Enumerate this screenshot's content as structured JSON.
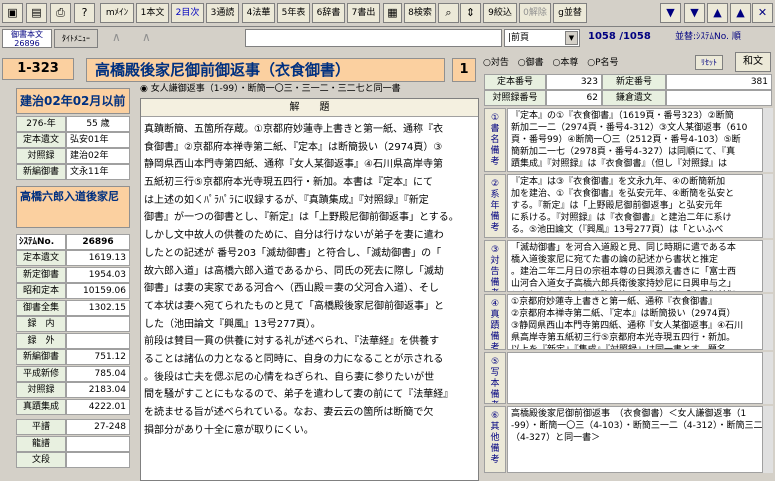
{
  "toolbar": {
    "buttons": [
      {
        "label": "mﾒｲﾝ"
      },
      {
        "label": "1本文"
      },
      {
        "label": "2目次"
      },
      {
        "label": "3通読"
      },
      {
        "label": "4法華"
      },
      {
        "label": "5年表"
      },
      {
        "label": "6辞書"
      },
      {
        "label": "7書出"
      },
      {
        "label": "8検索"
      },
      {
        "label": "9絞込"
      },
      {
        "label": "0解除"
      },
      {
        "label": "g並替"
      }
    ]
  },
  "tabs": {
    "main": "御書本文",
    "main_sub": "26896",
    "menu": "ﾀｲﾄﾒﾆｭｰ"
  },
  "nav": {
    "dropdown": "|前頁",
    "counter": "1058 /1058",
    "sort_label": "並替:ｼｽﾃﾑNo. 順"
  },
  "title": {
    "number": "1-323",
    "text": "高橋殿後家尼御前御返事（衣食御書）",
    "vol": "1"
  },
  "left": {
    "date_heading": "建治02年02月以前",
    "rows": [
      {
        "label": "276-年",
        "value": "55 歳"
      },
      {
        "label": "定本遺文",
        "value": "弘安01年"
      },
      {
        "label": "対照録",
        "value": "建治02年"
      },
      {
        "label": "新編御書",
        "value": "文永11年"
      }
    ],
    "recipient": "高橋六郎入道後家尼",
    "sysno_label": "ｼｽﾃﾑNo.",
    "sysno_value": "26896",
    "refs": [
      {
        "label": "定本遺文",
        "value": "1619.13"
      },
      {
        "label": "新定御書",
        "value": "1954.03"
      },
      {
        "label": "昭和定本",
        "value": "10159.06"
      },
      {
        "label": "御書全集",
        "value": "1302.15"
      },
      {
        "label": "録　内",
        "value": ""
      },
      {
        "label": "録　外",
        "value": ""
      },
      {
        "label": "新編御書",
        "value": "751.12"
      },
      {
        "label": "平成新修",
        "value": "785.04"
      },
      {
        "label": "対照録",
        "value": "2183.04"
      },
      {
        "label": "真蹟集成",
        "value": "4222.01"
      },
      {
        "label": "平譜",
        "value": "27-248"
      },
      {
        "label": "龍譜",
        "value": ""
      },
      {
        "label": "文段",
        "value": ""
      }
    ]
  },
  "middle": {
    "radio_text": "女人謙御返事（1-99）・断簡一〇三・三一二・三二七と同一書",
    "heading": "解　　題",
    "lines": [
      "真蹟断簡、五箇所存蔵。①京都府妙蓮寺上書きと第一紙、通称『衣",
      "食御書』②京都府本禅寺第二紙、『定本』は断簡扱い（2974頁）③",
      "静岡県西山本門寺第四紙、通称『女人某御返事』④石川県高岸寺第",
      "五紙初三行⑤京都府本光寺現五四行・新加。本書は『定本』にて",
      "は上述の如くﾊﾟﾗﾊﾟﾗに収録するが、『真蹟集成』『対照録』『新定",
      "御書』が一つの御書とし、『新定』は「上野殿尼御前御返事」とする。",
      "しかし文中故人の供養のために、自分は行けないが弟子を妻に遣わ",
      "したとの記述が 番号203「滅劫御書」と符合し、「滅劫御書」の「",
      "故六郎入道」は高橋六郎入道であるから、同氏の死去に際し「滅劫",
      "御書」は妻の実家である河合へ（西山殿＝妻の父河合入道）、そし",
      "て本状は妻へ宛てられたものと見て「高橋殿後家尼御前御返事」と",
      "した（池田論文『興風』13号277頁）。",
      "前段は賛目一貫の供養に対する礼が述べられ、『法華経』を供養す",
      "ることは諸仏の力となると同時に、自身の力になることが示される",
      "。後段は亡夫を偲ぶ尼の心情をねぎられ、自ら妻に参りたいが世",
      "間を騒がすことにもなるので、弟子を遣わして妻の前にて『法華経』",
      "を読ませる旨が述べられている。なお、妻云云の箇所は断簡で欠",
      "損部分があり十全に意が取りにくい。"
    ]
  },
  "right": {
    "radios": [
      "対告",
      "御書",
      "本尊",
      "P名号"
    ],
    "reset": "ﾘｾｯﾄ",
    "wabun": "和文",
    "info": [
      {
        "label": "定本番号",
        "value": "323",
        "label2": "新定番号",
        "value2": "381"
      },
      {
        "label": "対照録番号",
        "value": "62",
        "label2": "鎌倉遺文",
        "value2": ""
      }
    ],
    "sections": [
      {
        "tag": "①\n書\n名\n備\n考",
        "text": "『定本』の①『衣食御書』（1619頁・番号323）②断簡\n新加二一二（2974頁・番号4-312）③文人某御返事（610\n頁・番号99）④断簡一〇三（2512頁・番号4-103）⑤断\n簡新加二一七（2978頁・番号4-327）は同順にて、『真\n蹟集成』『対照録』は『衣食御書』（但し『対照録』は"
      },
      {
        "tag": "②\n系\n年\n備\n考",
        "text": "『定本』は③『衣食御書』を文永九年、④の断簡新加\n加を建治、①『衣食御書』を弘安元年、④断簡を弘安と\nする。『新定』は「上野殿尼御前御返事」と弘安元年\nに系ける。『対照録』は『衣食御書』と建治二年に系け\nる。⑤池田論文（『興風』13号277頁）は「といふべ"
      },
      {
        "tag": "③\n対\n告\n備\n考",
        "text": "「滅劫御書」を河合入道殿と見、同じ時期に遣である本\n橋入道後家尼に宛てた書の論の記述から書状と推定\n。建治二年二月日の宗祖本尊の日興添え書きに「富士西\n山河合入道女子高橋六郎兵衛後家持妙尼に日興申与之」\nとあり、およそそれ以降建治三年五月四日「寂尼御前御"
      },
      {
        "tag": "④\n真\n蹟\n備\n考",
        "text": "①京都府妙蓮寺上書きと第一紙、通称『衣食御書』\n②京都府本禅寺第二紙、『定本』は断簡扱い（2974頁）\n③静岡県西山本門寺第四紙、通称『女人某御返事』④石川\n県高岸寺第五紙初三行⑤京都府本光寺現五四行・新加。\n以上を『新定』『集成』『対照録』は同一書とす。題名"
      },
      {
        "tag": "⑤\n写\n本\n備\n考",
        "text": ""
      },
      {
        "tag": "⑥\n其\n他\n備\n考",
        "text": "高橋殿後家尼御前御返事　（衣食御書）＜女人謙御返事（1\n-99）・断簡一〇三（4-103）・断簡三一二（4-312）・断簡三二七\n（4-327）と同一書＞"
      }
    ]
  }
}
